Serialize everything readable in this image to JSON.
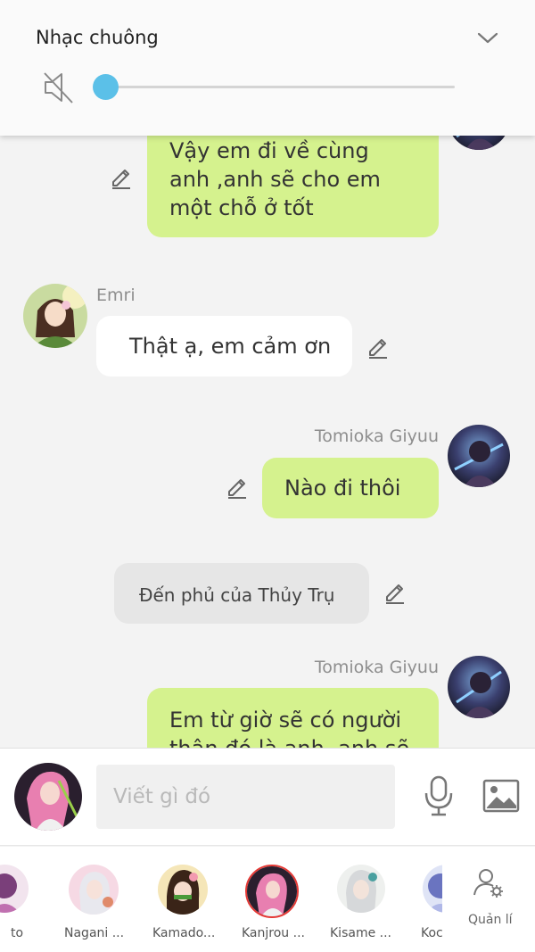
{
  "volume_panel": {
    "title": "Nhạc chuông",
    "level": 0,
    "icons": {
      "mute": "volume-mute-icon",
      "collapse": "chevron-down-icon"
    },
    "accent": "#5bc0e8"
  },
  "messages": [
    {
      "type": "outgoing",
      "text_lines": [
        "Vậy em đi về cùng",
        "anh ,anh sẽ cho em",
        "một chỗ ở tốt"
      ]
    },
    {
      "type": "incoming",
      "sender": "Emri",
      "text": "Thật ạ, em cảm ơn"
    },
    {
      "type": "outgoing",
      "sender": "Tomioka Giyuu",
      "text": "Nào đi thôi"
    },
    {
      "type": "narration",
      "text": "Đến phủ của Thủy Trụ"
    },
    {
      "type": "outgoing",
      "sender": "Tomioka Giyuu",
      "text_lines": [
        "Em từ giờ sẽ có người",
        "thân đó là anh, anh sẽ"
      ]
    }
  ],
  "input_bar": {
    "placeholder": "Viết gì đó",
    "icons": {
      "mic": "microphone-icon",
      "image": "image-icon"
    }
  },
  "characters": [
    {
      "name": "to"
    },
    {
      "name": "Nagani ..."
    },
    {
      "name": "Kamado..."
    },
    {
      "name": "Kanjrou ...",
      "selected": true
    },
    {
      "name": "Kisame ..."
    },
    {
      "name": "Koc"
    }
  ],
  "manage": {
    "label": "Quản lí",
    "icon": "user-settings-icon"
  },
  "colors": {
    "outgoing_bubble": "#d5f28e",
    "incoming_bubble": "#ffffff",
    "narration_bubble": "#e6e6e6",
    "selected_ring": "#e53935"
  }
}
